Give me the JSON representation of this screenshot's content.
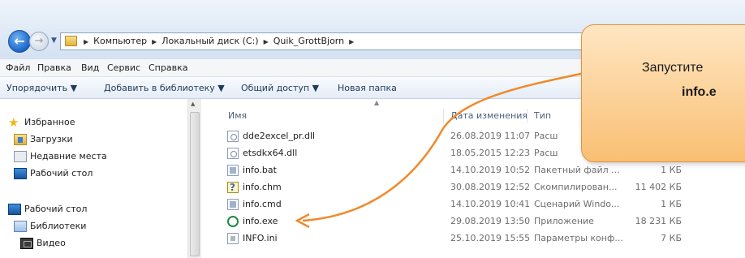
{
  "address_bar": {
    "breadcrumbs": [
      "Компьютер",
      "Локальный диск (C:)",
      "Quik_GrottBjorn"
    ]
  },
  "menu": [
    "Файл",
    "Правка",
    "Вид",
    "Сервис",
    "Справка"
  ],
  "toolbar": {
    "organize": "Упорядочить ▼",
    "add_to_library": "Добавить в библиотеку ▼",
    "share": "Общий доступ ▼",
    "new_folder": "Новая папка"
  },
  "nav_pane": {
    "favorites": "Избранное",
    "downloads": "Загрузки",
    "recent": "Недавние места",
    "desktop": "Рабочий стол",
    "desktop2": "Рабочий стол",
    "libraries": "Библиотеки",
    "video": "Видео"
  },
  "columns": {
    "name": "Имя",
    "date": "Дата изменения",
    "type": "Тип"
  },
  "files": [
    {
      "name": "dde2excel_pr.dll",
      "date": "26.08.2019 11:07",
      "type": "Расш",
      "size": "",
      "icon": "dll-icon"
    },
    {
      "name": "etsdkx64.dll",
      "date": "18.05.2015 12:23",
      "type": "Расш",
      "size": "",
      "icon": "dll-icon"
    },
    {
      "name": "info.bat",
      "date": "14.10.2019 10:52",
      "type": "Пакетный файл ...",
      "size": "1 КБ",
      "icon": "bat-icon"
    },
    {
      "name": "info.chm",
      "date": "30.08.2019 12:52",
      "type": "Скомпилирован...",
      "size": "11 402 КБ",
      "icon": "chm-icon"
    },
    {
      "name": "info.cmd",
      "date": "14.10.2019 10:41",
      "type": "Сценарий Windo...",
      "size": "1 КБ",
      "icon": "cmd-icon"
    },
    {
      "name": "info.exe",
      "date": "29.08.2019 13:50",
      "type": "Приложение",
      "size": "18 231 КБ",
      "icon": "exe-icon"
    },
    {
      "name": "INFO.ini",
      "date": "25.10.2019 15:55",
      "type": "Параметры конф...",
      "size": "7 КБ",
      "icon": "ini-icon"
    }
  ],
  "callout": {
    "line1": "Запустите",
    "line2": "info.e"
  },
  "colors": {
    "callout_fill": "#f9bf73",
    "arrow": "#f08a2b"
  }
}
